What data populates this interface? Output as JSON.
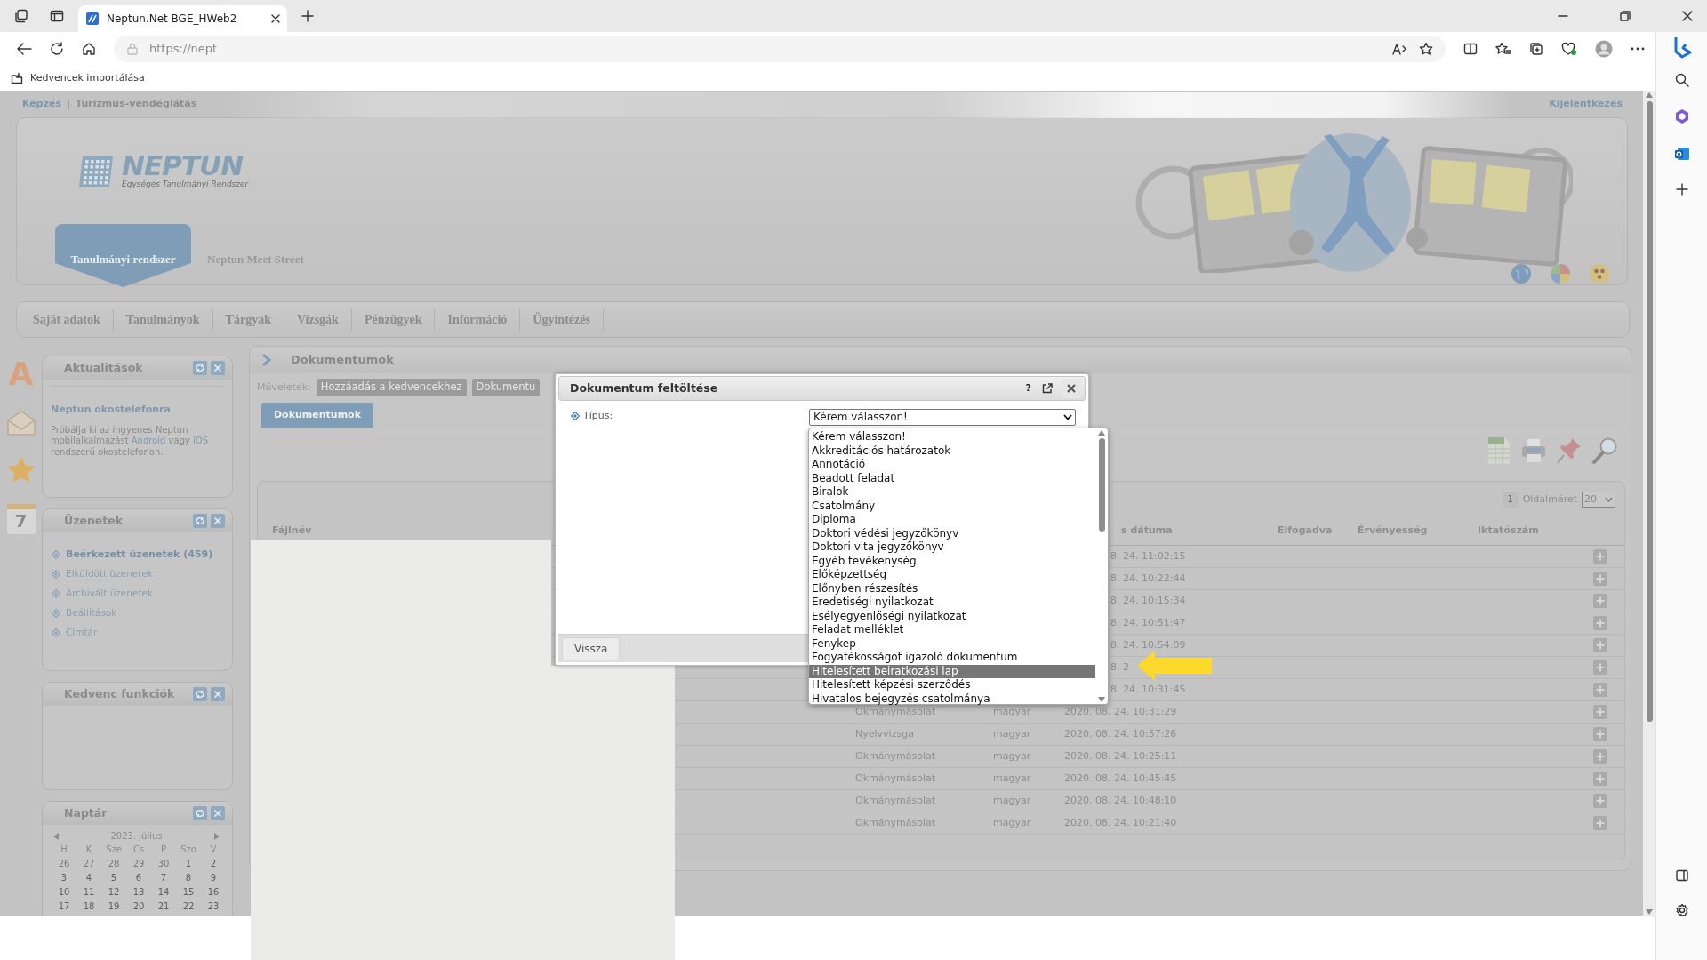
{
  "browser": {
    "tab": {
      "title": "Neptun.Net BGE_HWeb2",
      "selected": true
    },
    "url": "https://nept",
    "favorites_bar": {
      "import_label": "Kedvencek importálása"
    }
  },
  "page": {
    "breadcrumb": [
      {
        "text": "Képzés",
        "kind": "link"
      },
      {
        "text": "|",
        "kind": "separator"
      },
      {
        "text": "Turizmus-vendéglátás",
        "kind": "text"
      }
    ],
    "logout": "Kijelentkezés",
    "logo": {
      "name": "NEPTUN",
      "tagline": "Egységes Tanulmányi Rendszer"
    },
    "system_tabs": [
      {
        "label": "Tanulmányi rendszer",
        "selected": true
      },
      {
        "label": "Neptun Meet Street",
        "selected": false
      }
    ],
    "menu": [
      "Saját adatok",
      "Tanulmányok",
      "Tárgyak",
      "Vizsgák",
      "Pénzügyek",
      "Információ",
      "Ügyintézés"
    ],
    "side_icons": [
      {
        "kind": "letter",
        "text": "A"
      },
      {
        "kind": "envelope"
      },
      {
        "kind": "star"
      },
      {
        "kind": "calendar",
        "text": "7"
      }
    ],
    "news": {
      "title": "Aktualitások",
      "headline": "Neptun okostelefonra",
      "text_parts": [
        {
          "text": "Próbálja ki az ingyenes Neptun mobilalkalmazást ",
          "link": false
        },
        {
          "text": "Android",
          "link": true
        },
        {
          "text": " vagy ",
          "link": false
        },
        {
          "text": "iOS",
          "link": true
        },
        {
          "text": " rendszerű okostelefonon.",
          "link": false
        }
      ]
    },
    "messages": {
      "title": "Üzenetek",
      "items": [
        {
          "label": "Beérkezett üzenetek (459)",
          "unread": true
        },
        {
          "label": "Elküldött üzenetek",
          "unread": false
        },
        {
          "label": "Archivált üzenetek",
          "unread": false
        },
        {
          "label": "Beállítások",
          "unread": false
        },
        {
          "label": "Címtár",
          "unread": false
        }
      ]
    },
    "favorites": {
      "title": "Kedvenc funkciók"
    },
    "calendar": {
      "title": "Naptár",
      "month": "2023. július",
      "weekdays": [
        "H",
        "K",
        "Sze",
        "Cs",
        "P",
        "Szo",
        "V"
      ],
      "weeks": [
        [
          {
            "d": "26",
            "other_month": true
          },
          {
            "d": "27",
            "other_month": true
          },
          {
            "d": "28",
            "other_month": true
          },
          {
            "d": "29",
            "other_month": true
          },
          {
            "d": "30",
            "other_month": true
          },
          {
            "d": "1",
            "other_month": false
          },
          {
            "d": "2",
            "other_month": false
          }
        ],
        [
          {
            "d": "3",
            "other_month": false
          },
          {
            "d": "4",
            "other_month": false
          },
          {
            "d": "5",
            "other_month": false
          },
          {
            "d": "6",
            "other_month": false
          },
          {
            "d": "7",
            "other_month": false
          },
          {
            "d": "8",
            "other_month": false
          },
          {
            "d": "9",
            "other_month": false
          }
        ],
        [
          {
            "d": "10",
            "other_month": false
          },
          {
            "d": "11",
            "other_month": false
          },
          {
            "d": "12",
            "other_month": false
          },
          {
            "d": "13",
            "other_month": false
          },
          {
            "d": "14",
            "other_month": false
          },
          {
            "d": "15",
            "other_month": false
          },
          {
            "d": "16",
            "other_month": false
          }
        ],
        [
          {
            "d": "17",
            "other_month": false
          },
          {
            "d": "18",
            "other_month": false
          },
          {
            "d": "19",
            "other_month": false
          },
          {
            "d": "20",
            "other_month": false
          },
          {
            "d": "21",
            "other_month": false
          },
          {
            "d": "22",
            "other_month": false
          },
          {
            "d": "23",
            "other_month": false
          }
        ]
      ]
    },
    "documents": {
      "title": "Dokumentumok",
      "actions_label": "Műveletek:",
      "actions": [
        "Hozzáadás a kedvencekhez",
        "Dokumentu"
      ],
      "tabs": [
        {
          "label": "Dokumentumok",
          "selected": true
        }
      ],
      "pager": {
        "page": "1",
        "page_size_label": "Oldalméret",
        "page_size": "20"
      },
      "columns": [
        "Fájlnév",
        "s dátuma",
        "Elfogadva",
        "Érvényesség",
        "Iktatószám"
      ],
      "rows": [
        {
          "date": "8. 24. 11:02:15"
        },
        {
          "date": "8. 24. 10:22:44"
        },
        {
          "date": "8. 24. 10:15:34"
        },
        {
          "date": "8. 24. 10:51:47"
        },
        {
          "date": "8. 24. 10:54:09"
        },
        {
          "date": "8. 2"
        },
        {
          "date": "8. 24. 10:31:45"
        },
        {
          "type": "Okmánymásolat",
          "language": "magyar",
          "date": "2020. 08. 24. 10:31:29"
        },
        {
          "type": "Nyelvvizsga",
          "language": "magyar",
          "date": "2020. 08. 24. 10:57:26"
        },
        {
          "type": "Okmánymásolat",
          "language": "magyar",
          "date": "2020. 08. 24. 10:25:11"
        },
        {
          "type": "Okmánymásolat",
          "language": "magyar",
          "date": "2020. 08. 24. 10:45:45"
        },
        {
          "type": "Okmánymásolat",
          "language": "magyar",
          "date": "2020. 08. 24. 10:48:10"
        },
        {
          "type": "Okmánymásolat",
          "language": "magyar",
          "date": "2020. 08. 24. 10:21:40"
        }
      ]
    }
  },
  "dialog": {
    "title": "Dokumentum feltöltése",
    "help": "?",
    "field_label": "Típus:",
    "select_value": "Kérem válasszon!",
    "back_button": "Vissza",
    "options": [
      {
        "label": "Kérem válasszon!",
        "selected": false
      },
      {
        "label": "Akkreditációs határozatok",
        "selected": false
      },
      {
        "label": "Annotáció",
        "selected": false
      },
      {
        "label": "Beadott feladat",
        "selected": false
      },
      {
        "label": "Biralok",
        "selected": false
      },
      {
        "label": "Csatolmány",
        "selected": false
      },
      {
        "label": "Diploma",
        "selected": false
      },
      {
        "label": "Doktori védési jegyzőkönyv",
        "selected": false
      },
      {
        "label": "Doktori vita jegyzőkönyv",
        "selected": false
      },
      {
        "label": "Egyéb tevékenység",
        "selected": false
      },
      {
        "label": "Előképzettség",
        "selected": false
      },
      {
        "label": "Előnyben részesítés",
        "selected": false
      },
      {
        "label": "Eredetiségi nyilatkozat",
        "selected": false
      },
      {
        "label": "Esélyegyenlőségi nyilatkozat",
        "selected": false
      },
      {
        "label": "Feladat melléklet",
        "selected": false
      },
      {
        "label": "Fenykep",
        "selected": false
      },
      {
        "label": "Fogyatékosságot igazoló dokumentum",
        "selected": false
      },
      {
        "label": "Hitelesített beiratkozási lap",
        "selected": true
      },
      {
        "label": "Hitelesített képzési szerződés",
        "selected": false
      },
      {
        "label": "Hivatalos bejegyzés csatolmánya",
        "selected": false
      }
    ]
  }
}
